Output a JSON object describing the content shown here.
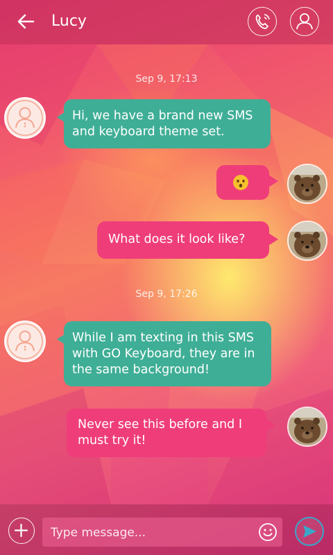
{
  "header": {
    "contact_name": "Lucy",
    "back_icon": "back-arrow-icon",
    "call_icon": "phone-icon",
    "profile_icon": "contact-profile-icon"
  },
  "conversation": {
    "timestamps": [
      "Sep 9, 17:13",
      "Sep 9, 17:26"
    ],
    "messages": [
      {
        "direction": "incoming",
        "text": "Hi, we have a brand new SMS and keyboard theme set.",
        "lines": [
          "Hi, we have a brand new SMS",
          "and keyboard theme set."
        ]
      },
      {
        "direction": "outgoing",
        "type": "emoji",
        "emoji": "hushed-face-emoji"
      },
      {
        "direction": "outgoing",
        "text": "What does it look like?"
      },
      {
        "direction": "incoming",
        "text": "While I am texting in this SMS with GO Keyboard, they are in the same background!",
        "lines": [
          "While I am texting in this SMS",
          "with GO Keyboard, they are in",
          "the same background!"
        ]
      },
      {
        "direction": "outgoing",
        "text": "Never see this before and I must try it!",
        "lines": [
          "Never see this before and I",
          "must try it!"
        ]
      }
    ]
  },
  "composer": {
    "placeholder": "Type message...",
    "add_icon": "add-attachment-icon",
    "emoji_icon": "smiley-icon",
    "send_icon": "send-icon"
  },
  "colors": {
    "incoming_bubble": "#3fae96",
    "outgoing_bubble": "#ef3d7a",
    "header_bar": "#be285a",
    "send_accent": "#3aa7c9"
  }
}
